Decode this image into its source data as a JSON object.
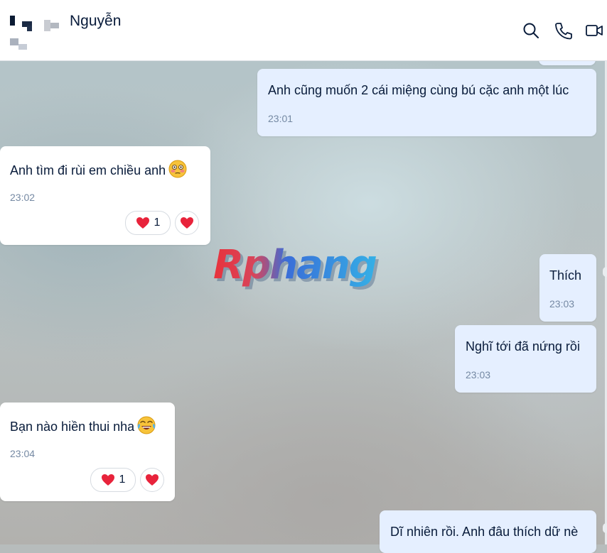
{
  "header": {
    "contact_name": "Nguyễn",
    "icons": [
      "search-icon",
      "phone-icon",
      "video-call-icon"
    ]
  },
  "watermark": {
    "text": "Rphang"
  },
  "messages": [
    {
      "direction": "outgoing",
      "text": "Anh cũng muốn 2 cái miệng cùng bú cặc anh một lúc",
      "time": "23:01"
    },
    {
      "direction": "incoming",
      "text": "Anh tìm đi rùi em chiều anh",
      "emoji": "flushed-face-emoji",
      "time": "23:02",
      "reactions": {
        "heart_count": "1"
      }
    },
    {
      "direction": "outgoing",
      "text": "Thích",
      "time": "23:03"
    },
    {
      "direction": "outgoing",
      "text": "Nghĩ tới đã nứng rồi",
      "time": "23:03"
    },
    {
      "direction": "incoming",
      "text": "Bạn nào hiền thui nha",
      "emoji": "tears-of-joy-emoji",
      "time": "23:04",
      "reactions": {
        "heart_count": "1"
      }
    },
    {
      "direction": "outgoing",
      "text": "Dĩ nhiên rồi. Anh đâu thích dữ nè",
      "time": ""
    }
  ],
  "colors": {
    "outgoing_bubble": "#e5efff",
    "incoming_bubble": "#ffffff",
    "heart": "#e8233b",
    "time_text": "#7589a3"
  }
}
